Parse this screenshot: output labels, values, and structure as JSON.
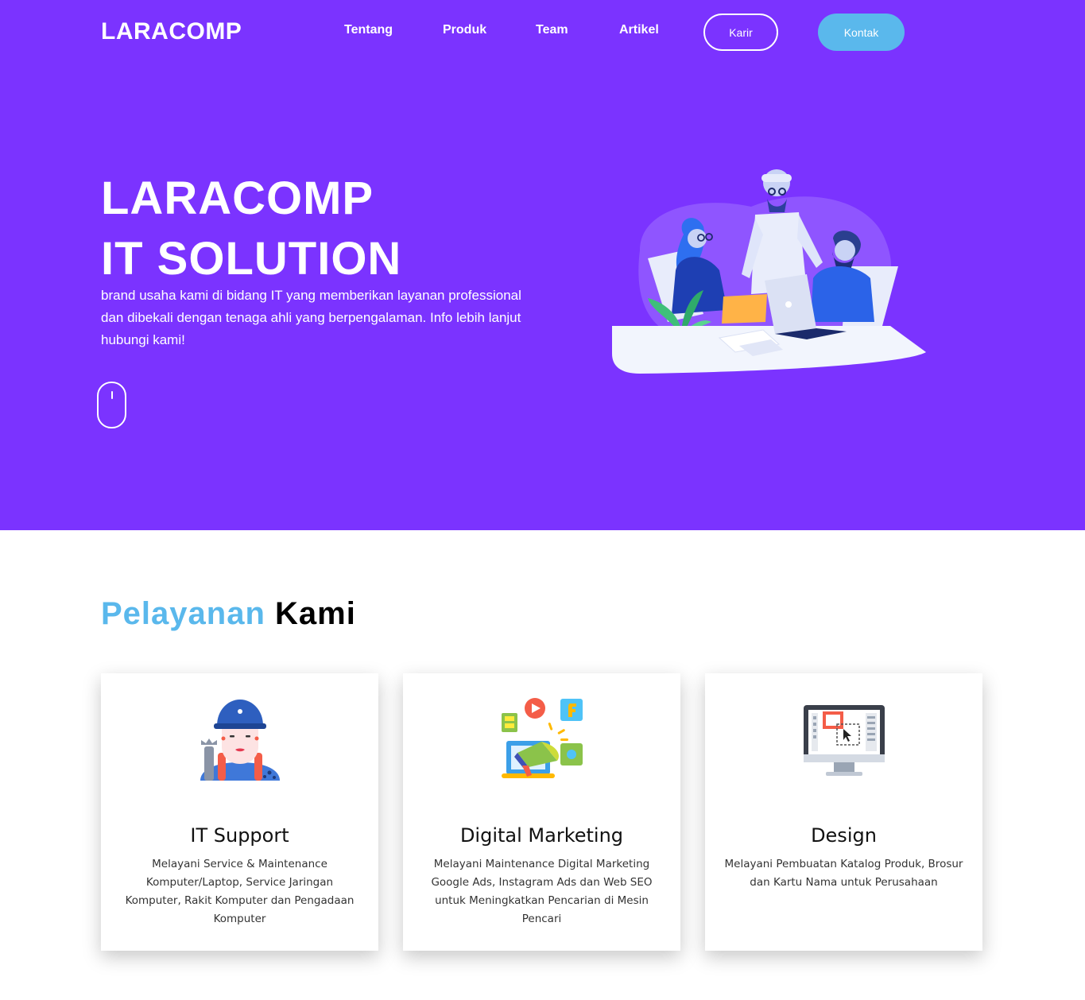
{
  "header": {
    "logo": "LARACOMP",
    "nav": [
      {
        "label": "Tentang"
      },
      {
        "label": "Produk"
      },
      {
        "label": "Team"
      },
      {
        "label": "Artikel"
      }
    ],
    "karir_label": "Karir",
    "kontak_label": "Kontak"
  },
  "hero": {
    "title_line1": "LARACOMP",
    "title_line2": "IT SOLUTION",
    "description": "brand usaha kami di bidang IT yang memberikan layanan professional dan dibekali dengan tenaga ahli yang berpengalaman. Info lebih lanjut hubungi kami!"
  },
  "services": {
    "title_highlight": "Pelayanan",
    "title_rest": "Kami",
    "items": [
      {
        "title": "IT Support",
        "description": "Melayani Service & Maintenance Komputer/Laptop, Service Jaringan Komputer, Rakit Komputer dan Pengadaan Komputer",
        "icon": "technician-icon"
      },
      {
        "title": "Digital Marketing",
        "description": "Melayani Maintenance Digital Marketing Google Ads, Instagram Ads dan Web SEO untuk Meningkatkan Pencarian di Mesin Pencari",
        "icon": "megaphone-icon"
      },
      {
        "title": "Design",
        "description": "Melayani Pembuatan Katalog Produk, Brosur dan Kartu Nama untuk Perusahaan",
        "icon": "monitor-design-icon"
      }
    ]
  },
  "colors": {
    "hero_bg": "#7b33ff",
    "accent": "#5ab8ec"
  }
}
